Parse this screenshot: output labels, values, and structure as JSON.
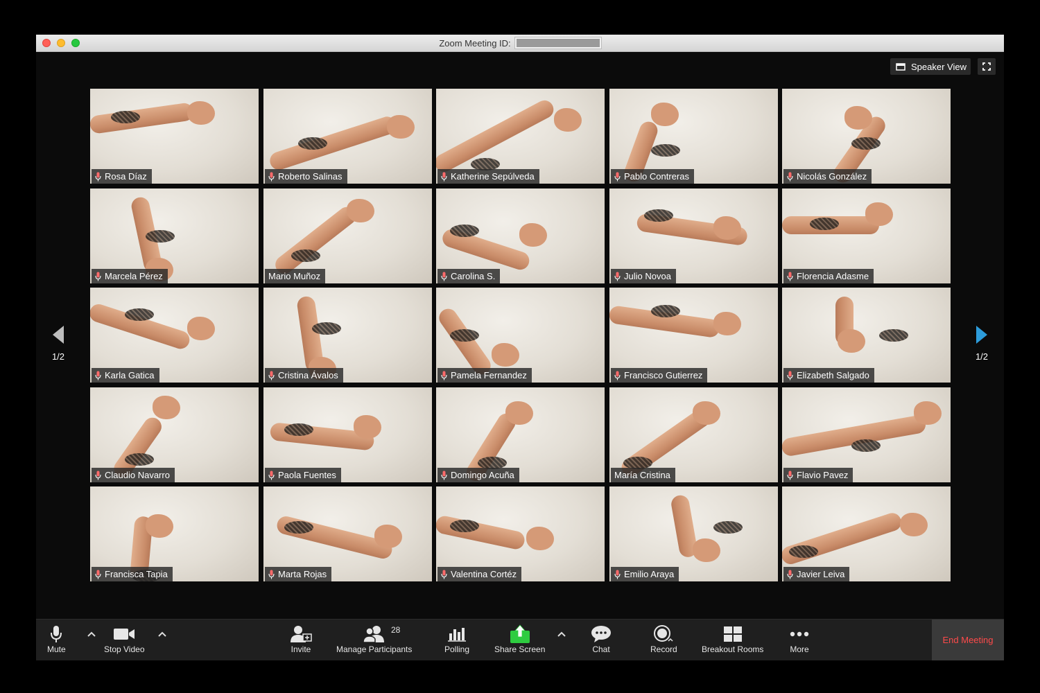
{
  "window": {
    "title_prefix": "Zoom Meeting ID:"
  },
  "view": {
    "speaker_view_label": "Speaker View",
    "page_indicator_left": "1/2",
    "page_indicator_right": "1/2"
  },
  "participants": [
    {
      "name": "Rosa Díaz",
      "mic": "on"
    },
    {
      "name": "Roberto Salinas",
      "mic": "on"
    },
    {
      "name": "Katherine Sepúlveda",
      "mic": "on"
    },
    {
      "name": "Pablo Contreras",
      "mic": "on"
    },
    {
      "name": "Nicolás González",
      "mic": "on"
    },
    {
      "name": "Marcela Pérez",
      "mic": "on"
    },
    {
      "name": "Mario Muñoz",
      "mic": "none"
    },
    {
      "name": "Carolina S.",
      "mic": "on"
    },
    {
      "name": "Julio Novoa",
      "mic": "on"
    },
    {
      "name": "Florencia Adasme",
      "mic": "on"
    },
    {
      "name": "Karla Gatica",
      "mic": "on"
    },
    {
      "name": "Cristina Ávalos",
      "mic": "on"
    },
    {
      "name": "Pamela Fernandez",
      "mic": "on"
    },
    {
      "name": "Francisco Gutierrez",
      "mic": "on"
    },
    {
      "name": "Elizabeth Salgado",
      "mic": "on"
    },
    {
      "name": "Claudio Navarro",
      "mic": "on"
    },
    {
      "name": "Paola Fuentes",
      "mic": "on"
    },
    {
      "name": "Domingo Acuña",
      "mic": "on"
    },
    {
      "name": "María Cristina",
      "mic": "none"
    },
    {
      "name": "Flavio Pavez",
      "mic": "on"
    },
    {
      "name": "Francisca Tapia",
      "mic": "on"
    },
    {
      "name": "Marta Rojas",
      "mic": "on"
    },
    {
      "name": "Valentina Cortéz",
      "mic": "on"
    },
    {
      "name": "Emilio Araya",
      "mic": "on"
    },
    {
      "name": "Javier Leiva",
      "mic": "on"
    }
  ],
  "toolbar": {
    "mute_label": "Mute",
    "stop_video_label": "Stop Video",
    "invite_label": "Invite",
    "manage_participants_label": "Manage Participants",
    "participant_count": "28",
    "polling_label": "Polling",
    "share_screen_label": "Share Screen",
    "chat_label": "Chat",
    "record_label": "Record",
    "breakout_rooms_label": "Breakout Rooms",
    "more_label": "More",
    "end_meeting_label": "End Meeting"
  },
  "colors": {
    "end_meeting_text": "#ff4a4a",
    "share_screen_icon": "#2ecc40",
    "mic_active": "#ff6b6b",
    "nav_arrow_active": "#2d9cdb"
  }
}
